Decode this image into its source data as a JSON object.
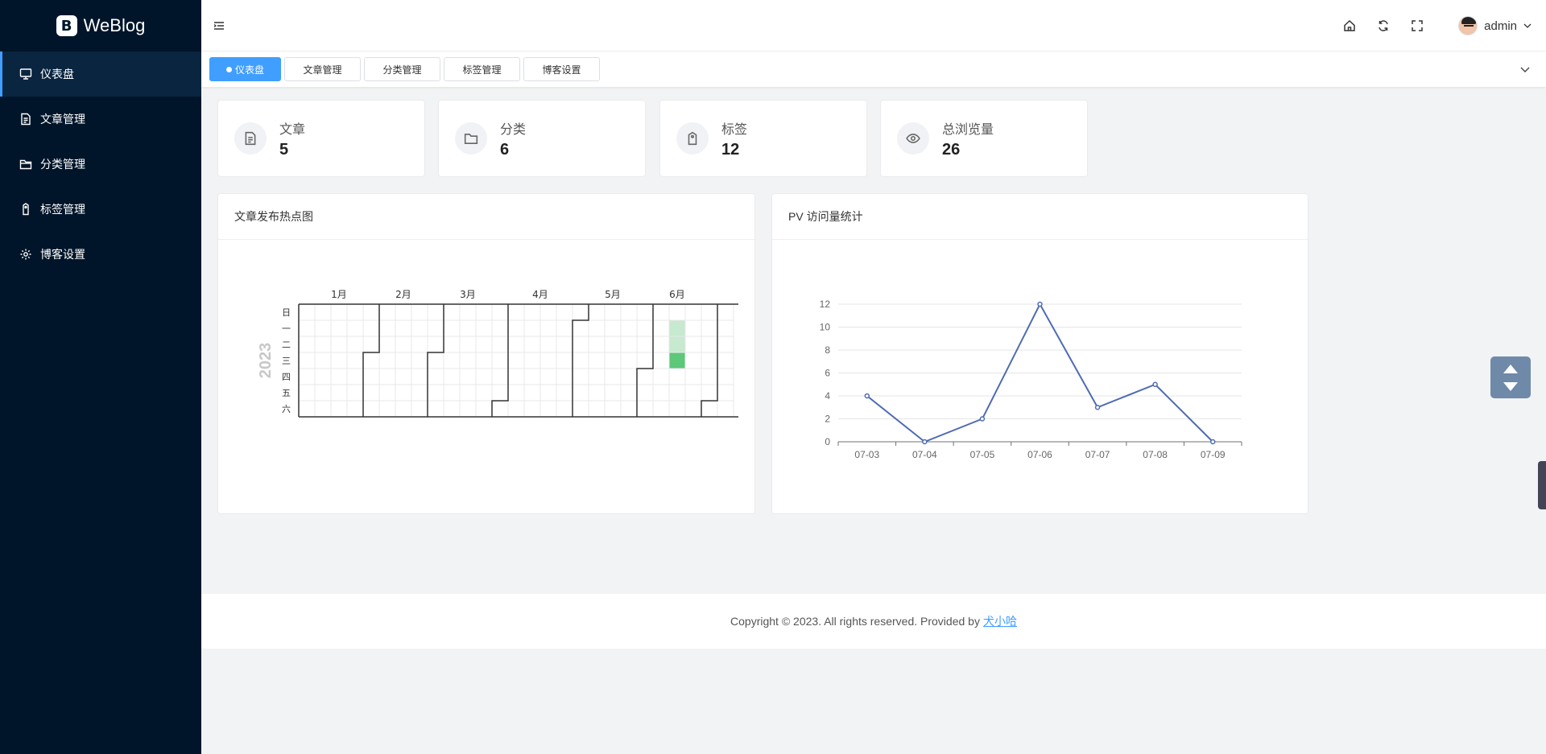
{
  "app": {
    "name": "WeBlog"
  },
  "sidebar": {
    "items": [
      {
        "label": "仪表盘",
        "icon": "monitor-icon",
        "active": true
      },
      {
        "label": "文章管理",
        "icon": "document-icon",
        "active": false
      },
      {
        "label": "分类管理",
        "icon": "folder-icon",
        "active": false
      },
      {
        "label": "标签管理",
        "icon": "tag-icon",
        "active": false
      },
      {
        "label": "博客设置",
        "icon": "gear-icon",
        "active": false
      }
    ]
  },
  "header": {
    "icons": [
      "home-icon",
      "refresh-icon",
      "fullscreen-icon"
    ],
    "user": "admin"
  },
  "tabs": [
    {
      "label": "仪表盘",
      "active": true
    },
    {
      "label": "文章管理",
      "active": false
    },
    {
      "label": "分类管理",
      "active": false
    },
    {
      "label": "标签管理",
      "active": false
    },
    {
      "label": "博客设置",
      "active": false
    }
  ],
  "stats": [
    {
      "label": "文章",
      "value": "5",
      "icon": "document-icon"
    },
    {
      "label": "分类",
      "value": "6",
      "icon": "folder-icon"
    },
    {
      "label": "标签",
      "value": "12",
      "icon": "tag-icon"
    },
    {
      "label": "总浏览量",
      "value": "26",
      "icon": "eye-icon"
    }
  ],
  "heatmap_panel": {
    "title": "文章发布热点图"
  },
  "pv_panel": {
    "title": "PV 访问量统计"
  },
  "chart_data": [
    {
      "type": "heatmap",
      "title": "文章发布热点图",
      "year": "2023",
      "month_labels": [
        "1月",
        "2月",
        "3月",
        "4月",
        "5月",
        "6月"
      ],
      "weekday_labels": [
        "日",
        "一",
        "二",
        "三",
        "四",
        "五",
        "六"
      ],
      "active_days": [
        {
          "week": 23,
          "weekday": 1,
          "level": 1
        },
        {
          "week": 23,
          "weekday": 2,
          "level": 1
        },
        {
          "week": 23,
          "weekday": 3,
          "level": 2
        }
      ],
      "colors": {
        "level1": "#c6e9cf",
        "level2": "#5cc878",
        "empty": "#ffffff",
        "grid": "#e8e8e8",
        "border": "#333333"
      }
    },
    {
      "type": "line",
      "title": "PV 访问量统计",
      "categories": [
        "07-03",
        "07-04",
        "07-05",
        "07-06",
        "07-07",
        "07-08",
        "07-09"
      ],
      "values": [
        4,
        0,
        2,
        12,
        3,
        5,
        0
      ],
      "ylim": [
        0,
        12
      ],
      "yticks": [
        0,
        2,
        4,
        6,
        8,
        10,
        12
      ],
      "grid": true,
      "color": "#4e6bb3"
    }
  ],
  "footer": {
    "text": "Copyright © 2023. All rights reserved. Provided by",
    "link": "犬小哈"
  }
}
